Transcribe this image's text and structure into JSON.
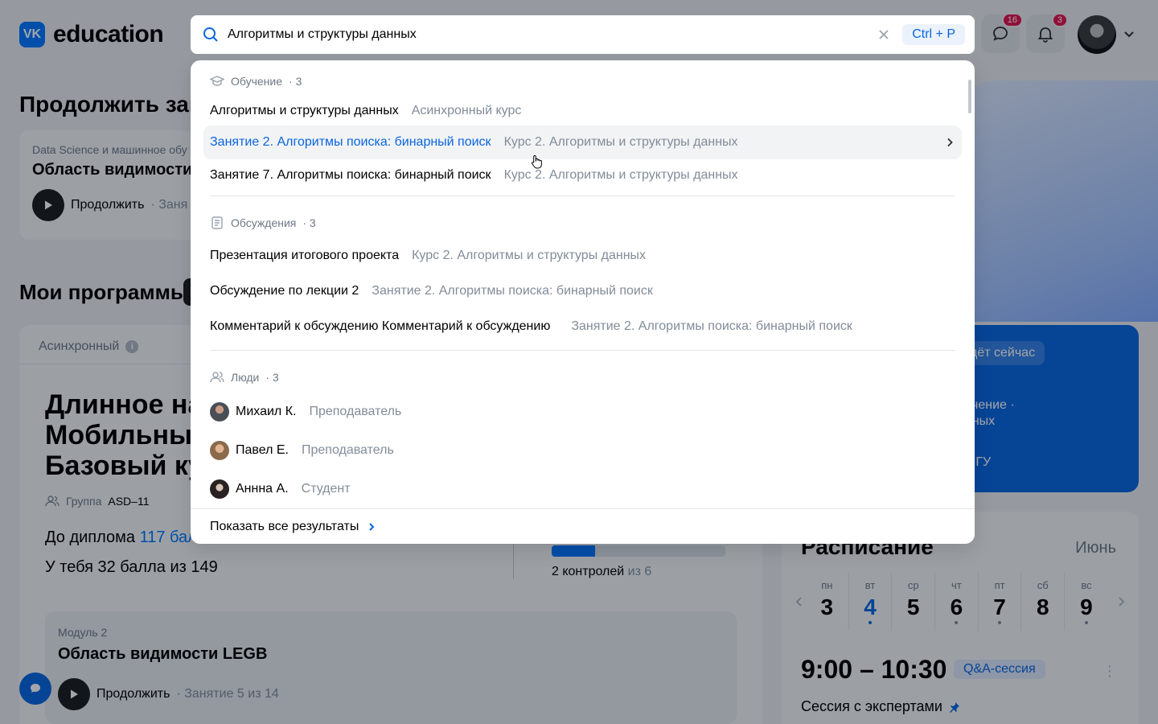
{
  "header": {
    "logo_mark": "VK",
    "logo_text": "education",
    "messages_badge": "16",
    "notifications_badge": "3"
  },
  "search": {
    "value": "Алгоритмы и структуры данных",
    "shortcut": "Ctrl + P"
  },
  "results": {
    "learning": {
      "label": "Обучение",
      "count": "· 3",
      "items": [
        {
          "title": "Алгоритмы и структуры данных",
          "sub": "Асинхронный курс"
        },
        {
          "title": "Занятие 2. Алгоритмы поиска: бинарный поиск",
          "sub": "Курс 2. Алгоритмы и структуры данных"
        },
        {
          "title": "Занятие 7. Алгоритмы поиска: бинарный поиск",
          "sub": "Курс 2. Алгоритмы и структуры данных"
        }
      ]
    },
    "discussions": {
      "label": "Обсуждения",
      "count": "· 3",
      "items": [
        {
          "title": "Презентация итогового проекта",
          "sub": "Курс 2. Алгоритмы и структуры данных"
        },
        {
          "title": "Обсуждение по лекции 2",
          "sub": "Занятие 2. Алгоритмы поиска: бинарный поиск"
        },
        {
          "title": "Комментарий к обсуждению Комментарий к обсуждению",
          "sub": "Занятие 2. Алгоритмы поиска: бинарный поиск"
        }
      ]
    },
    "people": {
      "label": "Люди",
      "count": "· 3",
      "items": [
        {
          "title": "Михаил К.",
          "sub": "Преподаватель"
        },
        {
          "title": "Павел Е.",
          "sub": "Преподаватель"
        },
        {
          "title": "Аннна А.",
          "sub": "Студент"
        }
      ]
    },
    "show_all": "Показать все результаты"
  },
  "continue": {
    "heading": "Продолжить зан",
    "category": "Data Science и машинное обу",
    "title": "Область видимости",
    "action": "Продолжить",
    "meta": "· Заня"
  },
  "programs": {
    "heading": "Мои программы",
    "tab": "Асинхронный",
    "title_l1": "Длинное наз",
    "title_l2": "Мобильный",
    "title_l3": "Базовый кур",
    "group_label": "Группа",
    "group_value": "ASD–11",
    "diploma_prefix": "До диплома",
    "diploma_value": "117 балл",
    "score": "У тебя 32 балла из 149",
    "controls_done": "2 контролей",
    "controls_total": "из 6",
    "controls_progress": 0.25,
    "module_label": "Модуль 2",
    "module_title": "Область видимости LEGB",
    "module_action": "Продолжить",
    "module_meta": "· Занятие 5 из 14"
  },
  "live": {
    "chip": "дёт сейчас",
    "text": "учение ·\nнных",
    "org": "МГУ"
  },
  "schedule": {
    "title": "Расписание",
    "month": "Июнь",
    "days": [
      {
        "w": "пн",
        "n": "3",
        "dot": false,
        "active": false
      },
      {
        "w": "вт",
        "n": "4",
        "dot": true,
        "active": true
      },
      {
        "w": "ср",
        "n": "5",
        "dot": false,
        "active": false
      },
      {
        "w": "чт",
        "n": "6",
        "dot": true,
        "active": false
      },
      {
        "w": "пт",
        "n": "7",
        "dot": true,
        "active": false
      },
      {
        "w": "сб",
        "n": "8",
        "dot": false,
        "active": false
      },
      {
        "w": "вс",
        "n": "9",
        "dot": true,
        "active": false
      }
    ],
    "time": "9:00 – 10:30",
    "tag": "Q&A-сессия",
    "session": "Сессия с экспертами"
  },
  "colors": {
    "accent": "#0a66e0",
    "badge": "#e3154e"
  }
}
